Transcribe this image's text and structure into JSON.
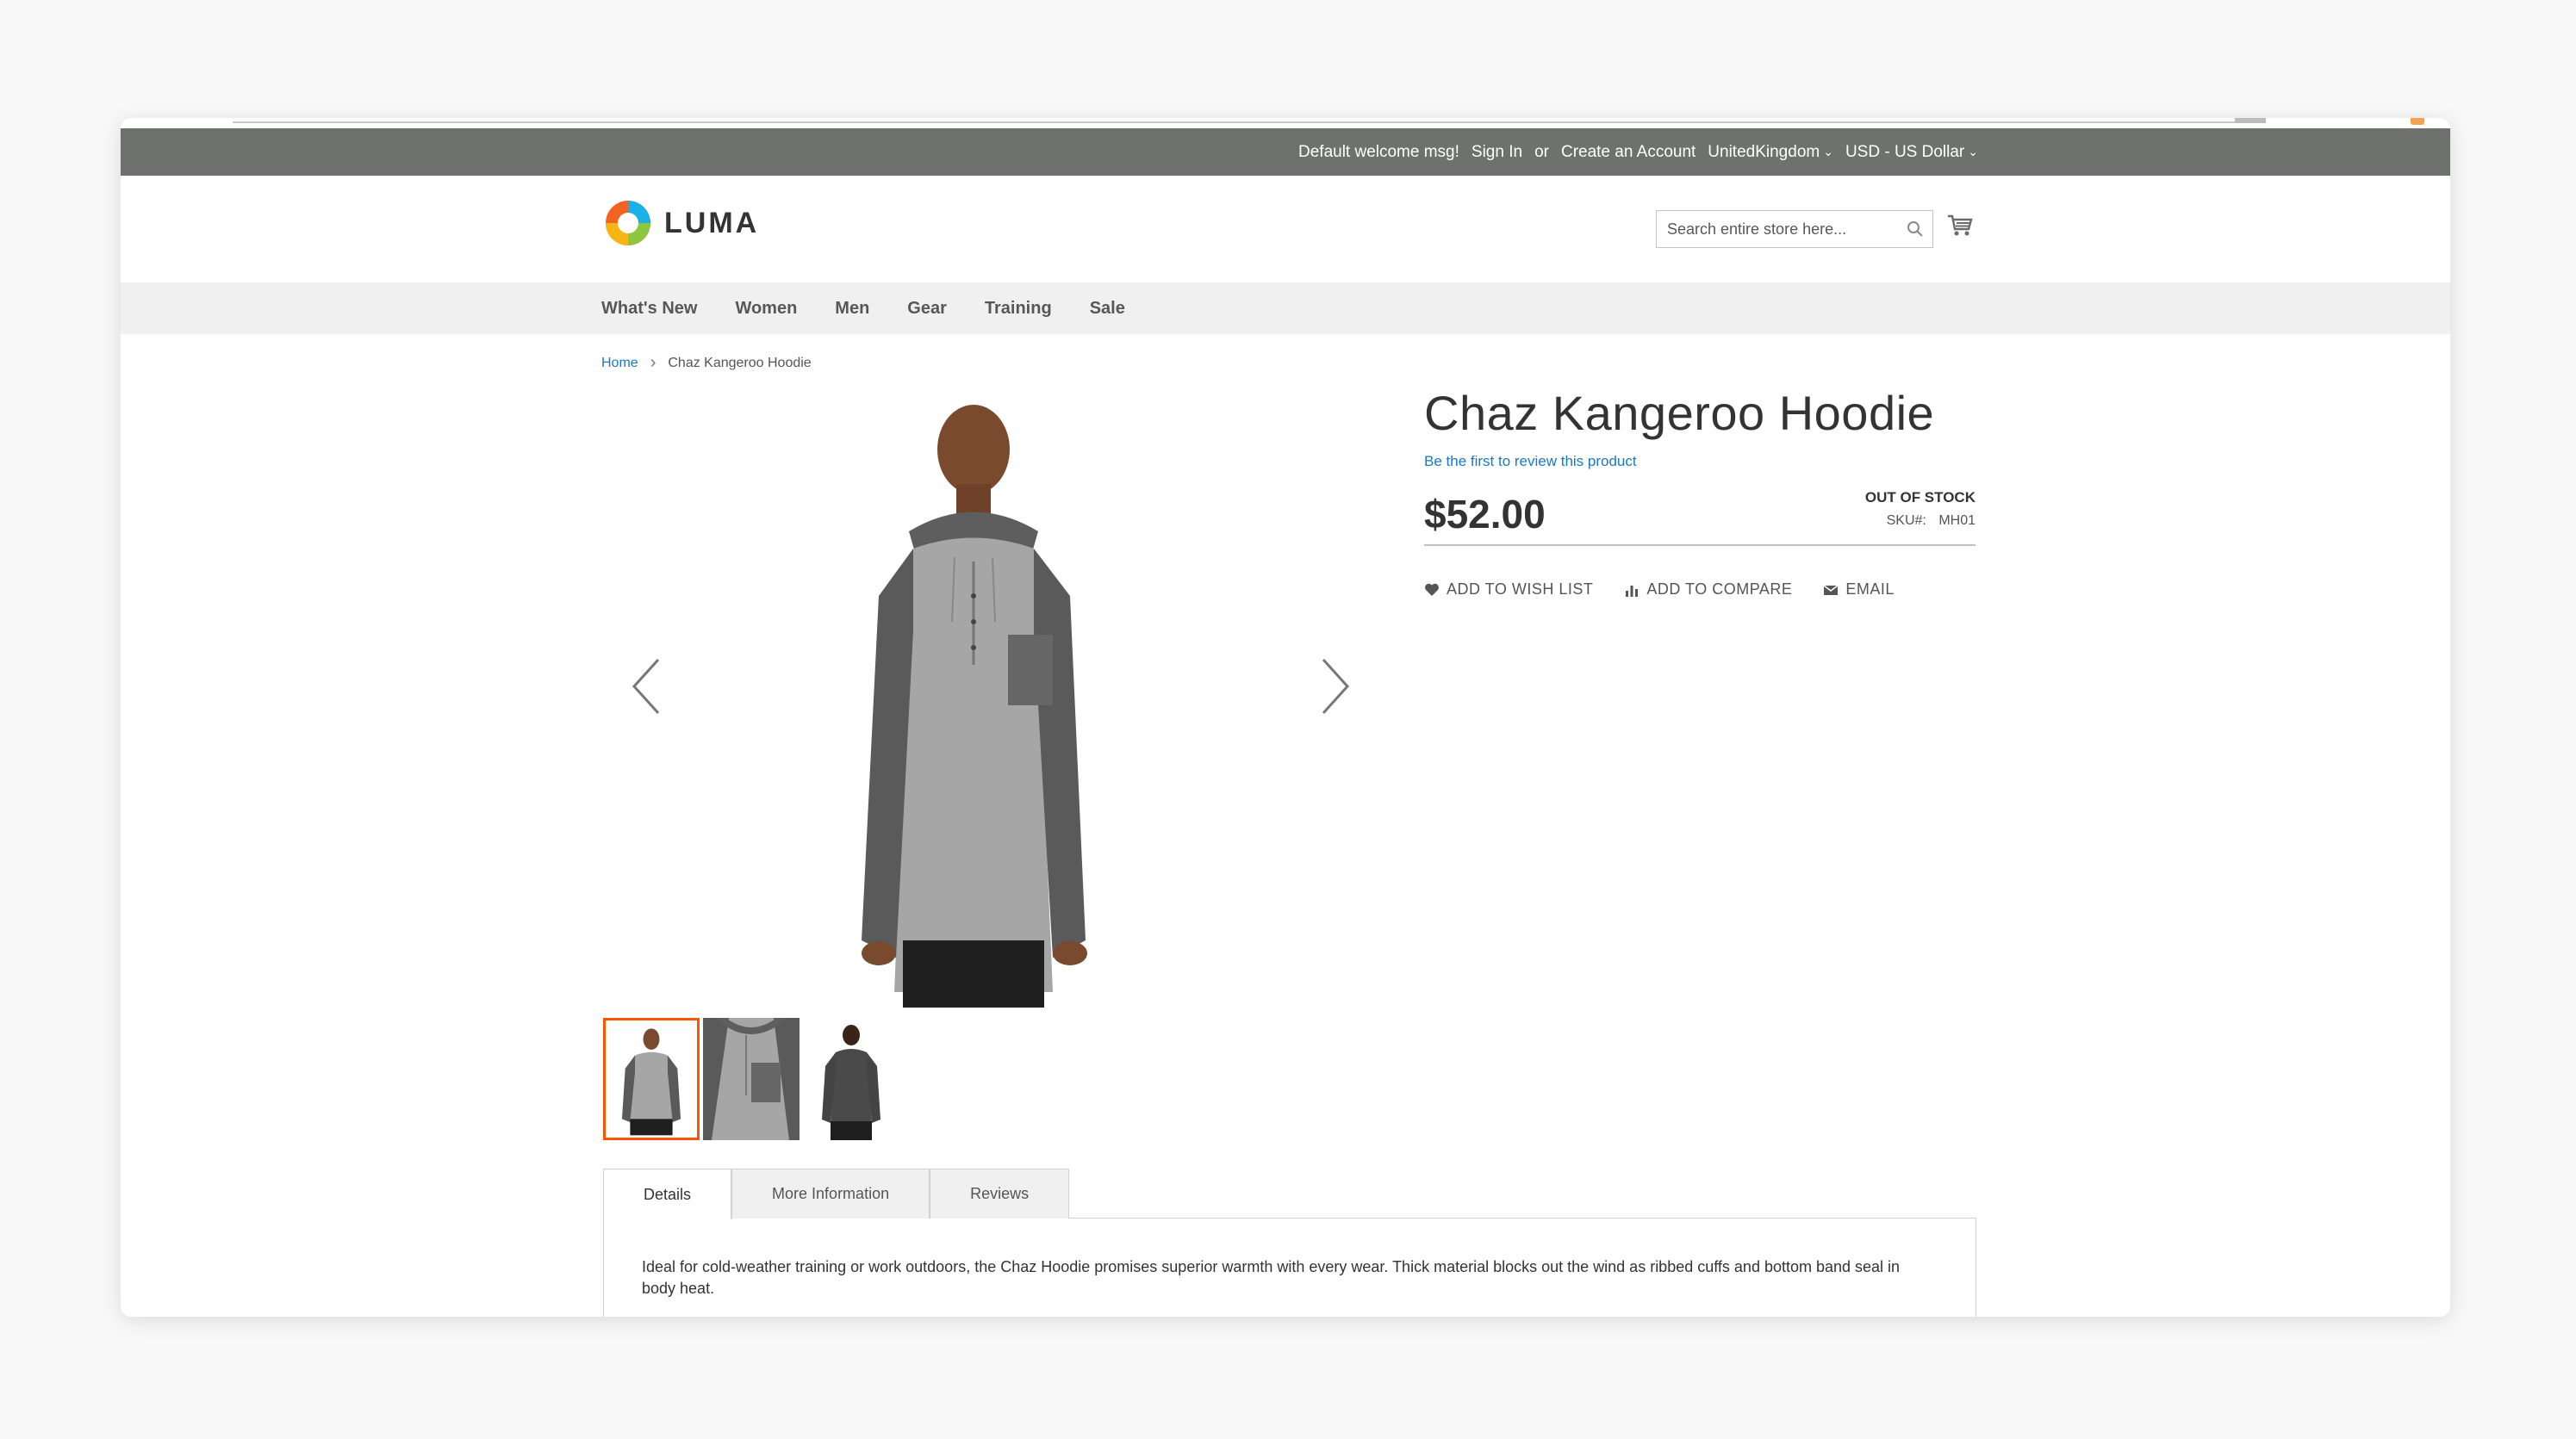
{
  "panel": {
    "welcome": "Default welcome msg!",
    "sign_in": "Sign In",
    "or": "or",
    "create_account": "Create an Account",
    "store_switcher": "UnitedKingdom",
    "currency_switcher": "USD - US Dollar"
  },
  "header": {
    "logo_text": "LUMA",
    "search_placeholder": "Search entire store here..."
  },
  "nav": {
    "items": [
      "What's New",
      "Women",
      "Men",
      "Gear",
      "Training",
      "Sale"
    ]
  },
  "breadcrumb": {
    "home": "Home",
    "separator": "›",
    "current": "Chaz Kangeroo Hoodie"
  },
  "product": {
    "title": "Chaz Kangeroo Hoodie",
    "review_link": "Be the first to review this product",
    "price": "$52.00",
    "stock": "OUT OF STOCK",
    "sku_label": "SKU#:",
    "sku_value": "MH01",
    "actions": {
      "wishlist": "ADD TO WISH LIST",
      "compare": "ADD TO COMPARE",
      "email": "EMAIL"
    }
  },
  "tabs": {
    "details": "Details",
    "more_info": "More Information",
    "reviews": "Reviews",
    "details_text": "Ideal for cold-weather training or work outdoors, the Chaz Hoodie promises superior warmth with every wear. Thick material blocks out the wind as ribbed cuffs and bottom band seal in body heat."
  },
  "colors": {
    "panel_bg": "#6e716e",
    "link": "#1979c3",
    "accent": "#ff5501",
    "nav_bg": "#f0f0f0"
  }
}
